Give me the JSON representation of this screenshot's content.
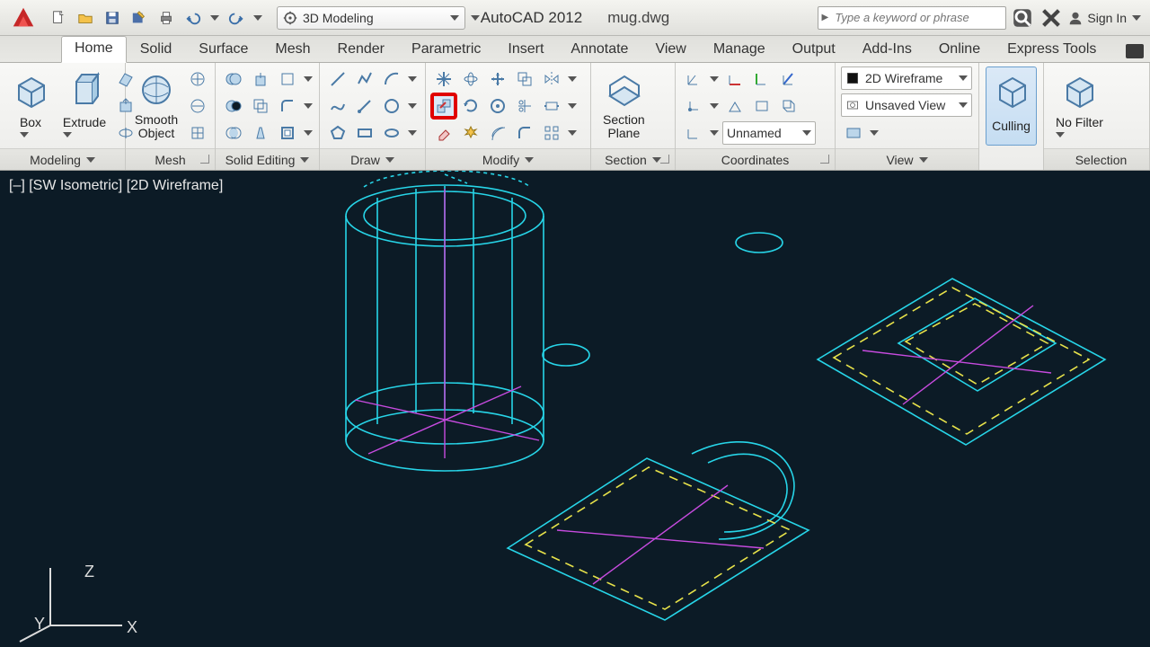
{
  "title": {
    "app": "AutoCAD 2012",
    "doc": "mug.dwg"
  },
  "workspace": "3D Modeling",
  "search_placeholder": "Type a keyword or phrase",
  "signin": "Sign In",
  "tabs": [
    "Home",
    "Solid",
    "Surface",
    "Mesh",
    "Render",
    "Parametric",
    "Insert",
    "Annotate",
    "View",
    "Manage",
    "Output",
    "Add-Ins",
    "Online",
    "Express Tools"
  ],
  "active_tab": 0,
  "ribbon": {
    "modeling": {
      "title": "Modeling",
      "box": "Box",
      "extrude": "Extrude"
    },
    "mesh": {
      "title": "Mesh",
      "smooth": "Smooth\nObject"
    },
    "solid_editing": {
      "title": "Solid Editing"
    },
    "draw": {
      "title": "Draw"
    },
    "modify": {
      "title": "Modify"
    },
    "section": {
      "title": "Section",
      "plane": "Section\nPlane"
    },
    "coordinates": {
      "title": "Coordinates",
      "named": "Unnamed"
    },
    "view": {
      "title": "View",
      "style": "2D Wireframe",
      "saved": "Unsaved View"
    },
    "culling": "Culling",
    "nofilter": "No Filter",
    "selection": {
      "title": "Selection"
    }
  },
  "viewport_label": "[–] [SW Isometric] [2D Wireframe]",
  "ucs": {
    "x": "X",
    "y": "Y",
    "z": "Z"
  }
}
